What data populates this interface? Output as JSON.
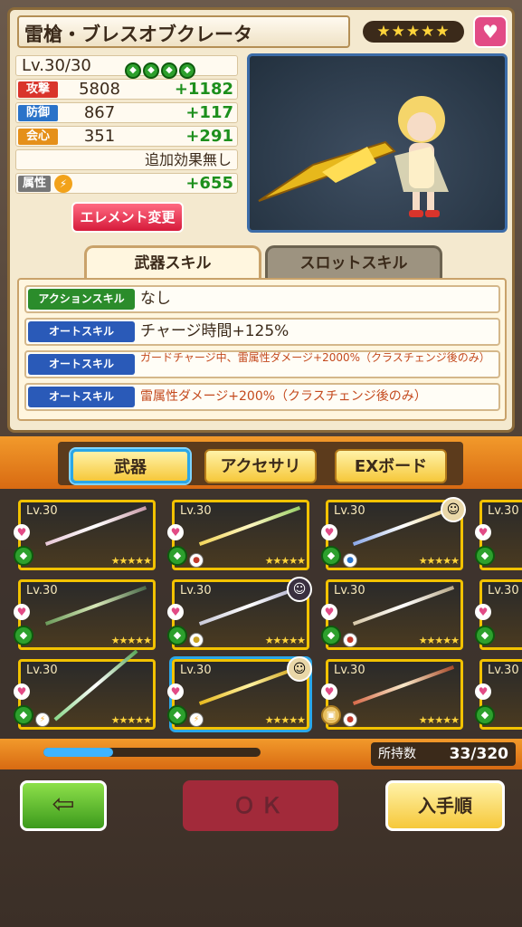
{
  "weapon": {
    "name": "雷槍・ブレスオブクレータ",
    "rarity_stars": "★★★★★",
    "level": "Lv.30/30",
    "gems": [
      "◆",
      "◆",
      "◆",
      "◆"
    ],
    "stats": [
      {
        "label": "攻撃",
        "value": "5808",
        "bonus": "+1182",
        "color": "#d9342b"
      },
      {
        "label": "防御",
        "value": "867",
        "bonus": "+117",
        "color": "#2a73c9"
      },
      {
        "label": "会心",
        "value": "351",
        "bonus": "+291",
        "color": "#e5901a"
      }
    ],
    "extra_effect": "追加効果無し",
    "attribute_label": "属性",
    "attribute_icon": "⚡",
    "attribute_bonus": "+655",
    "element_change_label": "エレメント変更"
  },
  "tabs": {
    "weapon_skill": "武器スキル",
    "slot_skill": "スロットスキル"
  },
  "skills": [
    {
      "type": "アクションスキル",
      "type_color": "#2b8c2b",
      "text": "なし"
    },
    {
      "type": "オートスキル",
      "type_color": "#2a5ab8",
      "text": "チャージ時間+125%"
    },
    {
      "type": "オートスキル",
      "type_color": "#2a5ab8",
      "text": "ガードチャージ中、雷属性ダメージ+2000%（クラスチェンジ後のみ）"
    },
    {
      "type": "オートスキル",
      "type_color": "#2a5ab8",
      "text": "雷属性ダメージ+200%（クラスチェンジ後のみ）"
    }
  ],
  "categories": {
    "weapon": "武器",
    "accessory": "アクセサリ",
    "ex_board": "EXボード"
  },
  "grid": {
    "level_label": "Lv.30",
    "stars": "★★★★★"
  },
  "inventory": {
    "label": "所持数",
    "count": "33/320",
    "scroll_fraction": 0.32
  },
  "footer": {
    "back_icon": "⇦",
    "ok_label": "ＯＫ",
    "sort_label": "入手順"
  }
}
